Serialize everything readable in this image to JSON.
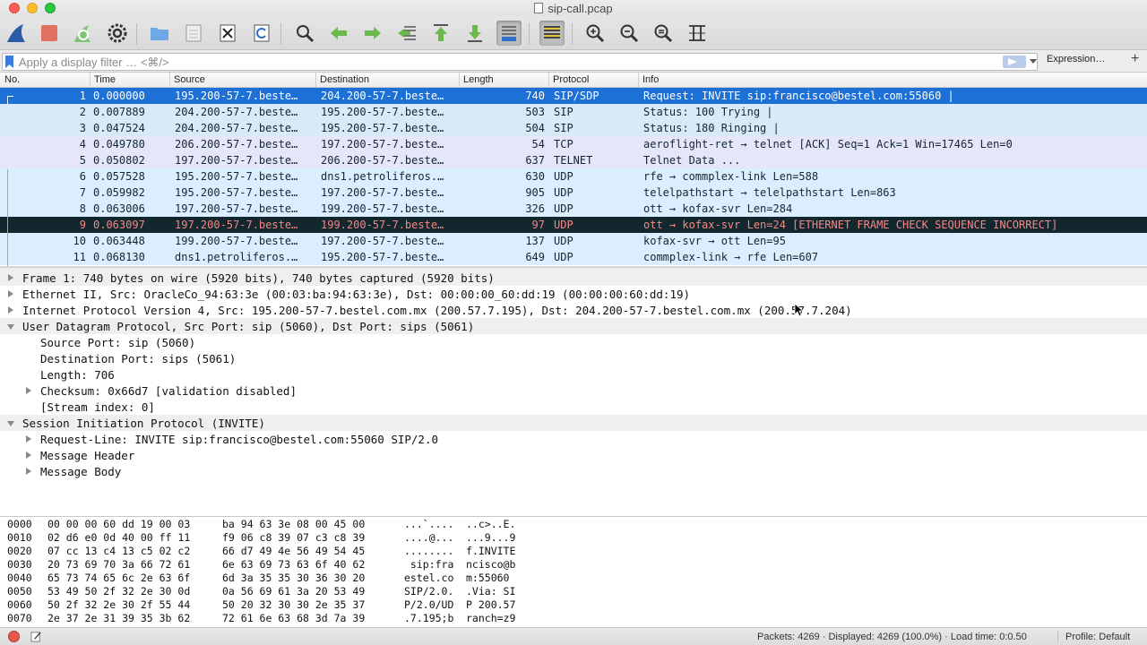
{
  "window": {
    "title": "sip-call.pcap"
  },
  "toolbar": {
    "buttons": [
      {
        "name": "start-capture-button",
        "icon": "shark-fin-icon"
      },
      {
        "name": "stop-capture-button",
        "icon": "stop-square-icon"
      },
      {
        "name": "restart-capture-button",
        "icon": "restart-fin-icon"
      },
      {
        "name": "capture-options-button",
        "icon": "gear-icon"
      },
      {
        "name": "open-file-button",
        "icon": "folder-icon"
      },
      {
        "name": "save-file-button",
        "icon": "file-icon"
      },
      {
        "name": "close-file-button",
        "icon": "close-file-icon"
      },
      {
        "name": "reload-file-button",
        "icon": "reload-icon"
      },
      {
        "name": "find-packet-button",
        "icon": "magnifier-icon"
      },
      {
        "name": "go-back-button",
        "icon": "arrow-left-icon"
      },
      {
        "name": "go-forward-button",
        "icon": "arrow-right-icon"
      },
      {
        "name": "go-to-packet-button",
        "icon": "goto-packet-icon"
      },
      {
        "name": "go-first-button",
        "icon": "arrow-up-icon"
      },
      {
        "name": "go-last-button",
        "icon": "arrow-down-icon"
      },
      {
        "name": "auto-scroll-button",
        "icon": "autoscroll-icon"
      },
      {
        "name": "colorize-button",
        "icon": "colorize-icon"
      },
      {
        "name": "zoom-in-button",
        "icon": "zoom-in-icon"
      },
      {
        "name": "zoom-out-button",
        "icon": "zoom-out-icon"
      },
      {
        "name": "normal-size-button",
        "icon": "zoom-reset-icon"
      },
      {
        "name": "resize-columns-button",
        "icon": "resize-columns-icon"
      }
    ]
  },
  "filter": {
    "placeholder": "Apply a display filter … <⌘/>",
    "expression_label": "Expression…",
    "add_label": "+"
  },
  "packet_list": {
    "columns": [
      "No.",
      "Time",
      "Source",
      "Destination",
      "Length",
      "Protocol",
      "Info"
    ],
    "rows": [
      {
        "no": "1",
        "time": "0.000000",
        "src": "195.200-57-7.beste…",
        "dst": "204.200-57-7.beste…",
        "len": "740",
        "proto": "SIP/SDP",
        "info": "Request: INVITE sip:francisco@bestel.com:55060 |",
        "style": "row-sel"
      },
      {
        "no": "2",
        "time": "0.007889",
        "src": "204.200-57-7.beste…",
        "dst": "195.200-57-7.beste…",
        "len": "503",
        "proto": "SIP",
        "info": "Status: 100 Trying |",
        "style": "row-sip"
      },
      {
        "no": "3",
        "time": "0.047524",
        "src": "204.200-57-7.beste…",
        "dst": "195.200-57-7.beste…",
        "len": "504",
        "proto": "SIP",
        "info": "Status: 180 Ringing |",
        "style": "row-sip"
      },
      {
        "no": "4",
        "time": "0.049780",
        "src": "206.200-57-7.beste…",
        "dst": "197.200-57-7.beste…",
        "len": "54",
        "proto": "TCP",
        "info": "aeroflight-ret → telnet [ACK] Seq=1 Ack=1 Win=17465 Len=0",
        "style": "row-tcp"
      },
      {
        "no": "5",
        "time": "0.050802",
        "src": "197.200-57-7.beste…",
        "dst": "206.200-57-7.beste…",
        "len": "637",
        "proto": "TELNET",
        "info": "Telnet Data ...",
        "style": "row-tcp"
      },
      {
        "no": "6",
        "time": "0.057528",
        "src": "195.200-57-7.beste…",
        "dst": "dns1.petroliferos.…",
        "len": "630",
        "proto": "UDP",
        "info": "rfe → commplex-link  Len=588",
        "style": "row-udp"
      },
      {
        "no": "7",
        "time": "0.059982",
        "src": "195.200-57-7.beste…",
        "dst": "197.200-57-7.beste…",
        "len": "905",
        "proto": "UDP",
        "info": "telelpathstart → telelpathstart  Len=863",
        "style": "row-udp"
      },
      {
        "no": "8",
        "time": "0.063006",
        "src": "197.200-57-7.beste…",
        "dst": "199.200-57-7.beste…",
        "len": "326",
        "proto": "UDP",
        "info": "ott → kofax-svr  Len=284",
        "style": "row-udp"
      },
      {
        "no": "9",
        "time": "0.063097",
        "src": "197.200-57-7.beste…",
        "dst": "199.200-57-7.beste…",
        "len": "97",
        "proto": "UDP",
        "info": "ott → kofax-svr  Len=24 [ETHERNET FRAME CHECK SEQUENCE INCORRECT]",
        "style": "row-bad"
      },
      {
        "no": "10",
        "time": "0.063448",
        "src": "199.200-57-7.beste…",
        "dst": "197.200-57-7.beste…",
        "len": "137",
        "proto": "UDP",
        "info": "kofax-svr → ott  Len=95",
        "style": "row-udp"
      },
      {
        "no": "11",
        "time": "0.068130",
        "src": "dns1.petroliferos.…",
        "dst": "195.200-57-7.beste…",
        "len": "649",
        "proto": "UDP",
        "info": "commplex-link → rfe  Len=607",
        "style": "row-udp"
      }
    ]
  },
  "details": [
    {
      "text": "Frame 1: 740 bytes on wire (5920 bits), 740 bytes captured (5920 bits)",
      "indent": 0,
      "arrow": "closed",
      "hl": true
    },
    {
      "text": "Ethernet II, Src: OracleCo_94:63:3e (00:03:ba:94:63:3e), Dst: 00:00:00_60:dd:19 (00:00:00:60:dd:19)",
      "indent": 0,
      "arrow": "closed",
      "hl": false
    },
    {
      "text": "Internet Protocol Version 4, Src: 195.200-57-7.bestel.com.mx (200.57.7.195), Dst: 204.200-57-7.bestel.com.mx (200.57.7.204)",
      "indent": 0,
      "arrow": "closed",
      "hl": false
    },
    {
      "text": "User Datagram Protocol, Src Port: sip (5060), Dst Port: sips (5061)",
      "indent": 0,
      "arrow": "open",
      "hl": true
    },
    {
      "text": "Source Port: sip (5060)",
      "indent": 1,
      "arrow": "",
      "hl": false
    },
    {
      "text": "Destination Port: sips (5061)",
      "indent": 1,
      "arrow": "",
      "hl": false
    },
    {
      "text": "Length: 706",
      "indent": 1,
      "arrow": "",
      "hl": false
    },
    {
      "text": "Checksum: 0x66d7 [validation disabled]",
      "indent": 1,
      "arrow": "closed",
      "hl": false
    },
    {
      "text": "[Stream index: 0]",
      "indent": 1,
      "arrow": "",
      "hl": false
    },
    {
      "text": "Session Initiation Protocol (INVITE)",
      "indent": 0,
      "arrow": "open",
      "hl": true
    },
    {
      "text": "Request-Line: INVITE sip:francisco@bestel.com:55060 SIP/2.0",
      "indent": 1,
      "arrow": "closed",
      "hl": false
    },
    {
      "text": "Message Header",
      "indent": 1,
      "arrow": "closed",
      "hl": false
    },
    {
      "text": "Message Body",
      "indent": 1,
      "arrow": "closed",
      "hl": false
    }
  ],
  "hex": [
    {
      "off": "0000",
      "b1": "00 00 00 60 dd 19 00 03",
      "b2": "ba 94 63 3e 08 00 45 00",
      "a1": "...`....",
      "a2": "..c>..E."
    },
    {
      "off": "0010",
      "b1": "02 d6 e0 0d 40 00 ff 11",
      "b2": "f9 06 c8 39 07 c3 c8 39",
      "a1": "....@...",
      "a2": "...9...9"
    },
    {
      "off": "0020",
      "b1": "07 cc 13 c4 13 c5 02 c2",
      "b2": "66 d7 49 4e 56 49 54 45",
      "a1": "........",
      "a2": "f.INVITE"
    },
    {
      "off": "0030",
      "b1": "20 73 69 70 3a 66 72 61",
      "b2": "6e 63 69 73 63 6f 40 62",
      "a1": " sip:fra",
      "a2": "ncisco@b"
    },
    {
      "off": "0040",
      "b1": "65 73 74 65 6c 2e 63 6f",
      "b2": "6d 3a 35 35 30 36 30 20",
      "a1": "estel.co",
      "a2": "m:55060 "
    },
    {
      "off": "0050",
      "b1": "53 49 50 2f 32 2e 30 0d",
      "b2": "0a 56 69 61 3a 20 53 49",
      "a1": "SIP/2.0.",
      "a2": ".Via: SI"
    },
    {
      "off": "0060",
      "b1": "50 2f 32 2e 30 2f 55 44",
      "b2": "50 20 32 30 30 2e 35 37",
      "a1": "P/2.0/UD",
      "a2": "P 200.57"
    },
    {
      "off": "0070",
      "b1": "2e 37 2e 31 39 35 3b 62",
      "b2": "72 61 6e 63 68 3d 7a 39",
      "a1": ".7.195;b",
      "a2": "ranch=z9"
    }
  ],
  "status": {
    "packets": "Packets: 4269 · Displayed: 4269 (100.0%) · Load time: 0:0.50",
    "profile": "Profile: Default"
  },
  "colors": {
    "selected": "#1d70d6",
    "sip": "#d8eafa",
    "tcp": "#e6e6fa",
    "udp": "#daeeff",
    "bad_bg": "#12272e",
    "bad_fg": "#f78787"
  }
}
